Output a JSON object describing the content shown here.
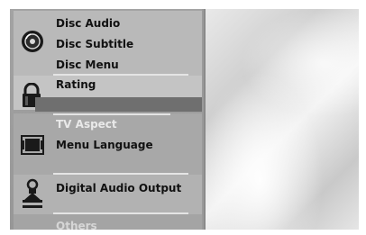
{
  "menu": {
    "disc_audio": "Disc Audio",
    "disc_subtitle": "Disc Subtitle",
    "disc_menu": "Disc Menu",
    "rating": "Rating",
    "tv_aspect": "TV Aspect",
    "menu_language": "Menu Language",
    "digital_audio_output": "Digital Audio Output",
    "others": "Others"
  },
  "icons": {
    "disc": "disc-icon",
    "lock": "lock-icon",
    "tv": "tv-icon",
    "audio": "speaker-icon"
  },
  "colors": {
    "panel": "#9a9a9a",
    "selection_bar": "#6f6f6f",
    "text_dark": "#111111",
    "text_light": "#e9e9e9"
  }
}
